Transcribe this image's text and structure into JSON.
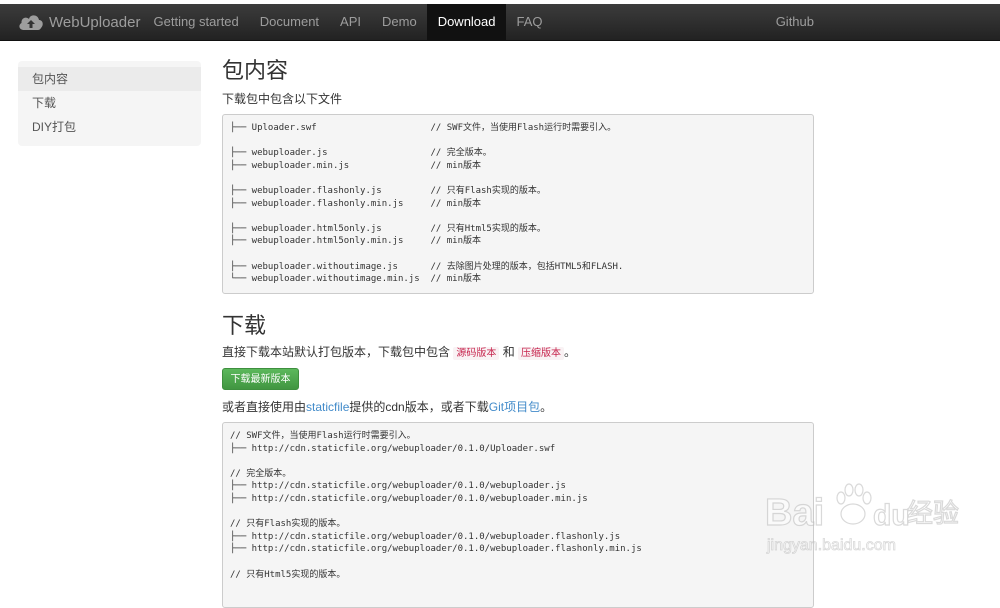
{
  "brand": {
    "name": "WebUploader"
  },
  "nav": {
    "items": [
      "Getting started",
      "Document",
      "API",
      "Demo",
      "Download",
      "FAQ"
    ],
    "active": "Download",
    "github": "Github"
  },
  "sidebar": {
    "items": [
      "包内容",
      "下载",
      "DIY打包"
    ]
  },
  "section1": {
    "title": "包内容",
    "lead": "下载包中包含以下文件",
    "code": "├── Uploader.swf                     // SWF文件，当使用Flash运行时需要引入。\n\n├── webuploader.js                   // 完全版本。\n├── webuploader.min.js               // min版本\n\n├── webuploader.flashonly.js         // 只有Flash实现的版本。\n├── webuploader.flashonly.min.js     // min版本\n\n├── webuploader.html5only.js         // 只有Html5实现的版本。\n├── webuploader.html5only.min.js     // min版本\n\n├── webuploader.withoutimage.js      // 去除图片处理的版本，包括HTML5和FLASH.\n└── webuploader.withoutimage.min.js  // min版本"
  },
  "section2": {
    "title": "下载",
    "text_before": "直接下载本站默认打包版本，下载包中包含",
    "code1": "源码版本",
    "text_and": " 和 ",
    "code2": "压缩版本",
    "text_after": "。",
    "button": "下载最新版本",
    "cdn_text1": "或者直接使用由",
    "cdn_link1": "staticfile",
    "cdn_text2": "提供的cdn版本，或者下载",
    "cdn_link2": "Git项目包",
    "cdn_text3": "。",
    "code": "// SWF文件，当使用Flash运行时需要引入。\n├── http://cdn.staticfile.org/webuploader/0.1.0/Uploader.swf\n\n// 完全版本。\n├── http://cdn.staticfile.org/webuploader/0.1.0/webuploader.js\n├── http://cdn.staticfile.org/webuploader/0.1.0/webuploader.min.js\n\n// 只有Flash实现的版本。\n├── http://cdn.staticfile.org/webuploader/0.1.0/webuploader.flashonly.js\n├── http://cdn.staticfile.org/webuploader/0.1.0/webuploader.flashonly.min.js\n\n// 只有Html5实现的版本。"
  },
  "watermark": {
    "text1": "Bai",
    "text2": "du",
    "text3": "经验",
    "url": "jingyan.baidu.com"
  },
  "colors": {
    "navbar": "#222222",
    "active_tab": "#111111",
    "button": "#5cb85c",
    "link": "#428bca",
    "code_inline": "#c7254e"
  }
}
